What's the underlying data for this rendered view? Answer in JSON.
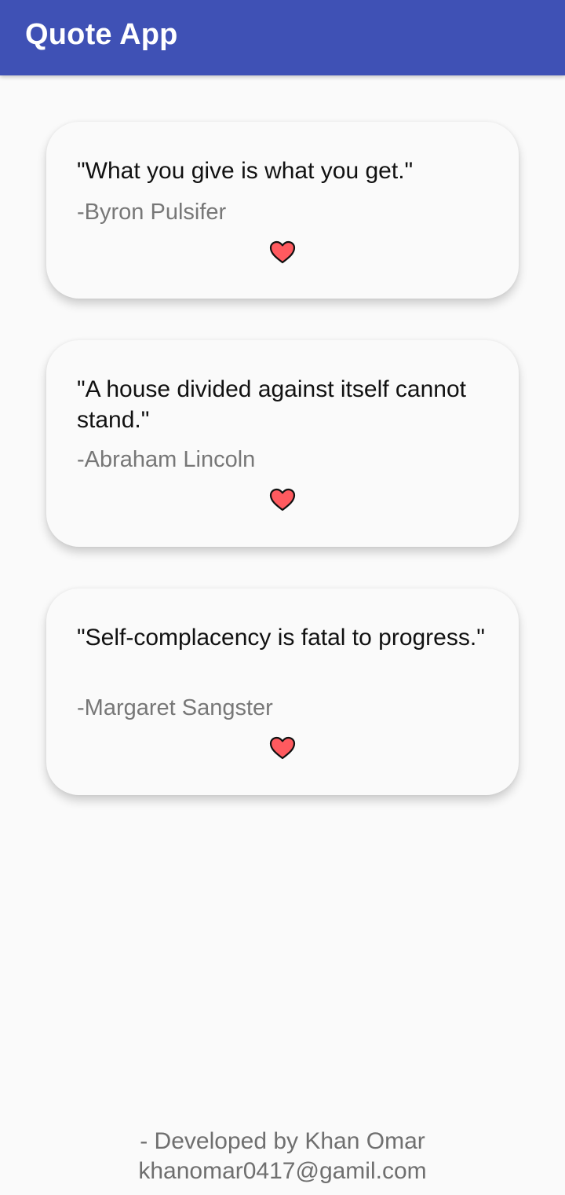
{
  "app_bar": {
    "title": "Quote App"
  },
  "quotes": [
    {
      "text": "\"What you give is what you get.\"",
      "author": "-Byron Pulsifer",
      "icon": "heart-icon"
    },
    {
      "text": "\"A house divided against itself cannot stand.\"",
      "author": "-Abraham Lincoln",
      "icon": "heart-icon"
    },
    {
      "text": "\"Self-complacency is fatal to progress.\"",
      "author": "-Margaret Sangster",
      "icon": "heart-icon"
    }
  ],
  "footer": {
    "developer": "- Developed by Khan Omar",
    "email": "khanomar0417@gamil.com"
  },
  "colors": {
    "app_bar": "#3f51b5",
    "background": "#fafafa",
    "heart_fill": "#ff5a5f",
    "heart_outline": "#111111"
  }
}
